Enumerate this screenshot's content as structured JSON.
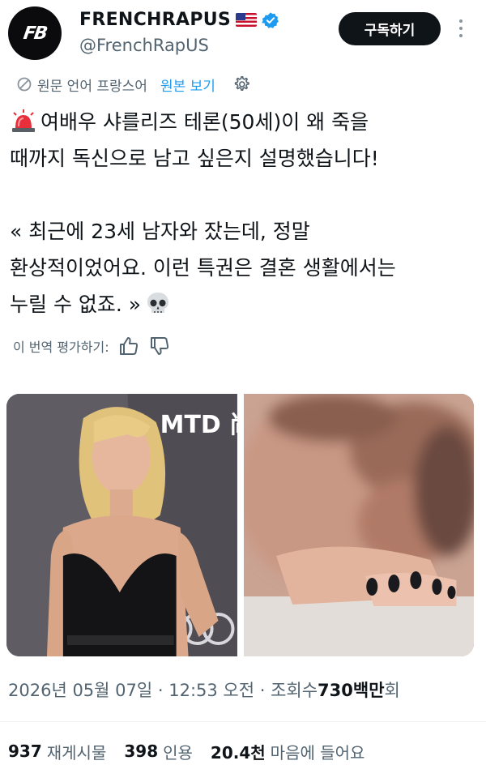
{
  "author": {
    "display_name": "FRENCHRAPUS",
    "handle": "@FrenchRapUS",
    "avatar_text": "FB",
    "verified_color": "#1d9bf0"
  },
  "subscribe_label": "구독하기",
  "translation": {
    "label": "원문 언어 프랑스어",
    "show_original": "원본 보기"
  },
  "tweet": {
    "line1": "여배우 샤를리즈 테론(50세)이 왜 죽을\n때까지 독신으로 남고 싶은지 설명했습니다!\n\n« 최근에 23세 남자와 잤는데, 정말\n환상적이었어요. 이런 특권은 결혼 생활에서는\n누릴 수 없죠. »"
  },
  "rate_translation_label": "이 번역 평가하기:",
  "media_text": {
    "backdrop_logo": "MTD 尚"
  },
  "timestamp": {
    "date_time": "2026년 05월 07일 · 12:53 오전 · 조회수 ",
    "views": "730백만",
    "views_suffix": "회"
  },
  "stats": {
    "reposts_count": "937",
    "reposts_label": "재게시물",
    "quotes_count": "398",
    "quotes_label": "인용",
    "likes_count": "20.4천",
    "likes_label": "마음에 들어요"
  },
  "colors": {
    "accent": "#1d9bf0",
    "text_primary": "#0f1419",
    "text_secondary": "#536471",
    "button_bg": "#0f1419"
  }
}
